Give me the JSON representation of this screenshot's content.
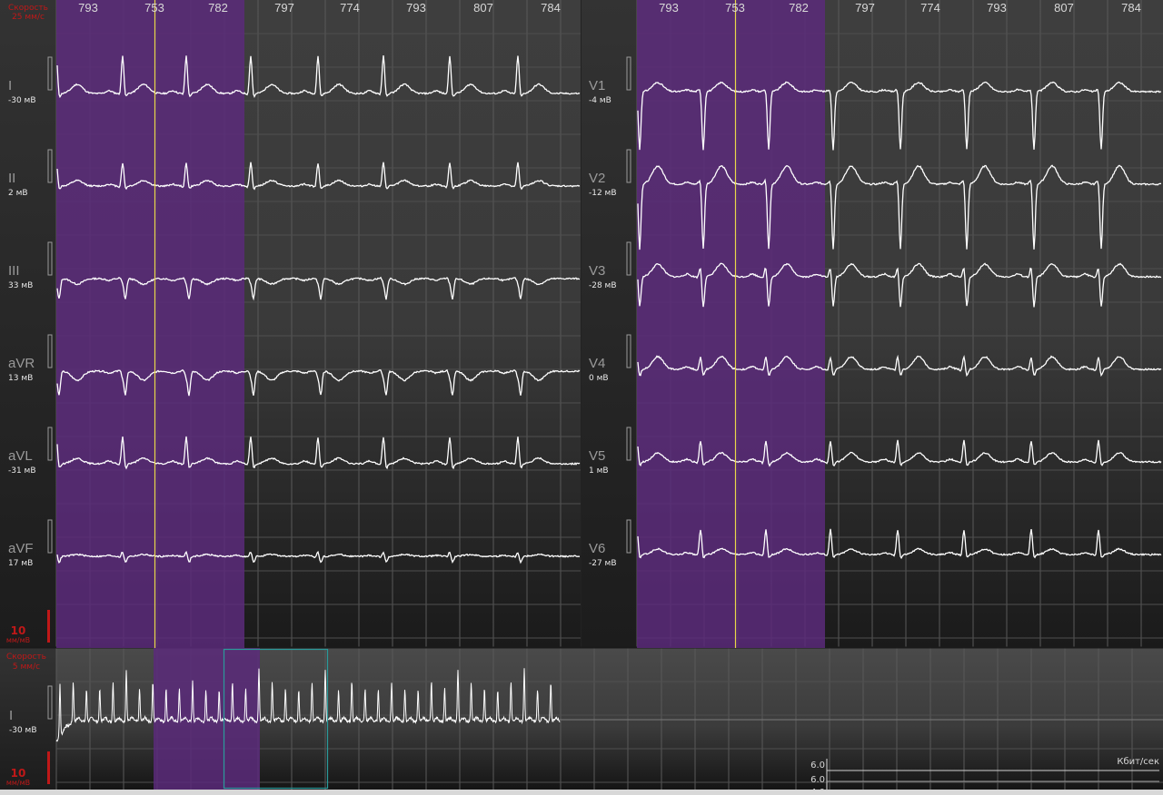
{
  "top": {
    "speed_label": "Скорость",
    "speed_value": "25 мм/с",
    "rr_intervals": [
      "793",
      "753",
      "782",
      "797",
      "774",
      "793",
      "807",
      "784"
    ],
    "gain_value": "10",
    "gain_unit": "мм/мВ",
    "left_leads": [
      {
        "name": "I",
        "offset": "-30 мВ"
      },
      {
        "name": "II",
        "offset": "2 мВ"
      },
      {
        "name": "III",
        "offset": "33 мВ"
      },
      {
        "name": "aVR",
        "offset": "13 мВ"
      },
      {
        "name": "aVL",
        "offset": "-31 мВ"
      },
      {
        "name": "aVF",
        "offset": "17 мВ"
      }
    ],
    "right_leads": [
      {
        "name": "V1",
        "offset": "-4 мВ"
      },
      {
        "name": "V2",
        "offset": "-12 мВ"
      },
      {
        "name": "V3",
        "offset": "-28 мВ"
      },
      {
        "name": "V4",
        "offset": "0 мВ"
      },
      {
        "name": "V5",
        "offset": "1 мВ"
      },
      {
        "name": "V6",
        "offset": "-27 мВ"
      }
    ]
  },
  "bottom": {
    "speed_label": "Скорость",
    "speed_value": "5 мм/с",
    "lead_name": "I",
    "lead_offset": "-30 мВ",
    "gain_value": "10",
    "gain_unit": "мм/мВ",
    "throughput_unit": "Кбит/сек",
    "throughput_ticks": [
      "6.0",
      "6.0",
      "4.0"
    ]
  },
  "colors": {
    "selection": "#5a2a7a",
    "cursor": "#e8d84a",
    "viewport": "#2a9a9a",
    "trace": "#ffffff",
    "accent": "#c01818"
  }
}
